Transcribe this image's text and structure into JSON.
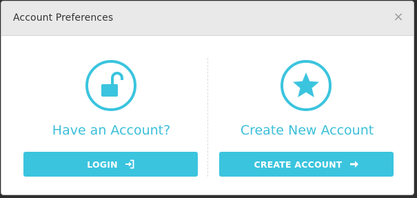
{
  "dialog": {
    "title": "Account Preferences",
    "close_glyph": "×"
  },
  "login_panel": {
    "icon": "unlock-icon",
    "heading": "Have an Account?",
    "button_label": "LOGIN",
    "button_icon": "sign-in-icon"
  },
  "register_panel": {
    "icon": "star-icon",
    "heading": "Create New Account",
    "button_label": "CREATE ACCOUNT",
    "button_icon": "arrow-right-icon"
  },
  "colors": {
    "accent": "#3bc4de",
    "heading_text": "#3bbfd9",
    "header_bg": "#e9e9e9"
  }
}
